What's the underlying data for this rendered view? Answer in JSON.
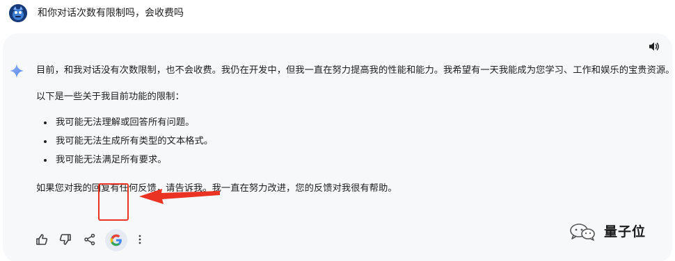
{
  "user_query": {
    "text": "和你对话次数有限制吗，会收费吗"
  },
  "response": {
    "paragraph_1": "目前，和我对话没有次数限制，也不会收费。我仍在开发中，但我一直在努力提高我的性能和能力。我希望有一天我能成为您学习、工作和娱乐的宝贵资源。",
    "paragraph_2": "以下是一些关于我目前功能的限制：",
    "bullets": [
      "我可能无法理解或回答所有问题。",
      "我可能无法生成所有类型的文本格式。",
      "我可能无法满足所有要求。"
    ],
    "paragraph_3": "如果您对我的回复有任何反馈，请告诉我。我一直在努力改进，您的反馈对我很有帮助。"
  },
  "actions": {
    "icons": [
      "thumbs-up-icon",
      "thumbs-down-icon",
      "share-icon",
      "google-icon",
      "more-vertical-icon"
    ]
  },
  "annotation": {
    "highlight_color": "#ea3323"
  },
  "watermark": {
    "text": "量子位"
  },
  "colors": {
    "card_background": "#f7f8fa",
    "google_button_background": "#e6eaf3"
  }
}
